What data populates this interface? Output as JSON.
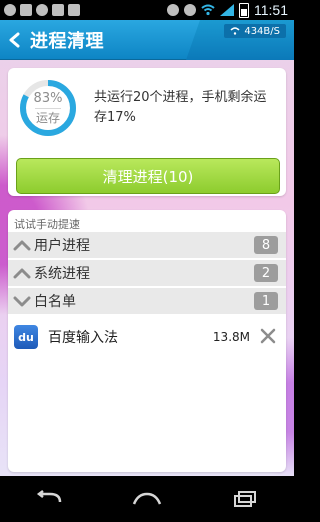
{
  "status_bar": {
    "time": "11:51"
  },
  "header": {
    "title": "进程清理",
    "speed": "434B/S"
  },
  "summary": {
    "memory_percent_text": "83%",
    "memory_percent_value": 0.83,
    "memory_label": "运存",
    "description": "共运行20个进程，手机剩余运存17%",
    "clean_button": "清理进程(10)"
  },
  "process_panel": {
    "header": "试试手动提速",
    "sections": [
      {
        "label": "用户进程",
        "count": "8",
        "expanded": false
      },
      {
        "label": "系统进程",
        "count": "2",
        "expanded": false
      },
      {
        "label": "白名单",
        "count": "1",
        "expanded": true
      }
    ],
    "whitelist_items": [
      {
        "name": "百度输入法",
        "memory": "13.8M"
      }
    ]
  },
  "colors": {
    "header_blue": "#0b79b9",
    "button_green": "#8dcc2e",
    "gauge_blue": "#2aa8e0",
    "badge_gray": "#9d9d9d"
  },
  "icons": [
    "back-arrow-icon",
    "wifi-icon",
    "chevron-up-icon",
    "chevron-down-icon",
    "close-icon",
    "baidu-input-icon"
  ]
}
